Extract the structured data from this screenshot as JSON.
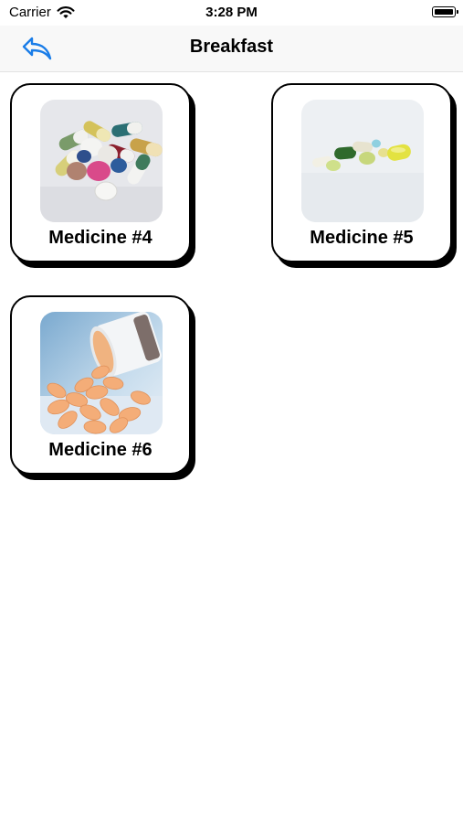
{
  "status_bar": {
    "carrier": "Carrier",
    "time": "3:28 PM"
  },
  "nav": {
    "title": "Breakfast",
    "back_icon": "reply-arrow-icon",
    "accent_color": "#1a7de8"
  },
  "medicines": [
    {
      "label": "Medicine #4",
      "image": "assorted-pills-image"
    },
    {
      "label": "Medicine #5",
      "image": "softgel-capsules-image"
    },
    {
      "label": "Medicine #6",
      "image": "spilled-tablets-bottle-image"
    }
  ]
}
